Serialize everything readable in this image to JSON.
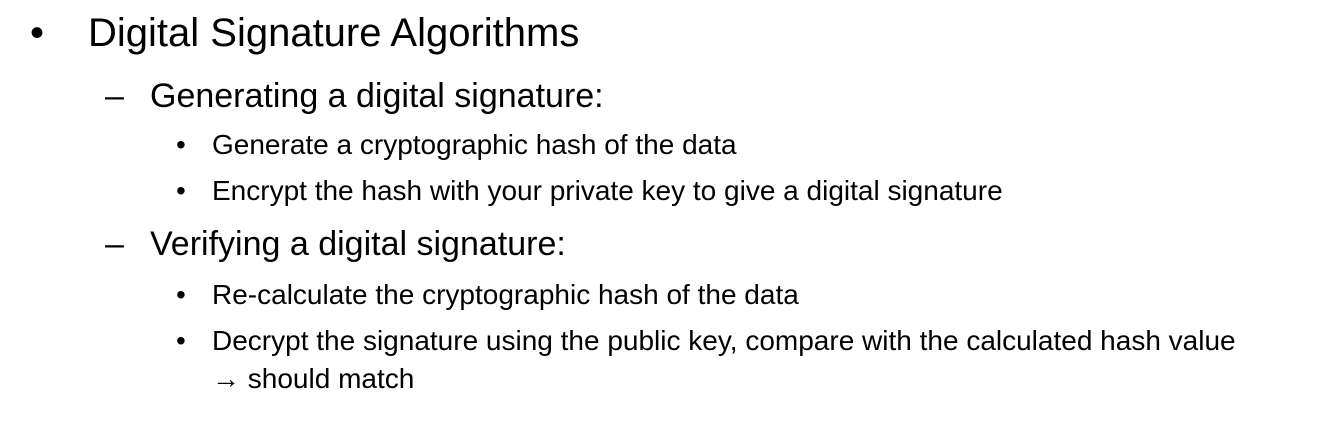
{
  "slide": {
    "heading": {
      "bullet": "•",
      "text": "Digital Signature Algorithms"
    },
    "sections": [
      {
        "dash": "–",
        "title": "Generating a digital signature:",
        "items": [
          {
            "bullet": "•",
            "text": "Generate a cryptographic hash of the data"
          },
          {
            "bullet": "•",
            "text": "Encrypt the hash with your private key to give a digital signature"
          }
        ]
      },
      {
        "dash": "–",
        "title": "Verifying a digital signature:",
        "items": [
          {
            "bullet": "•",
            "text": "Re-calculate the cryptographic hash of the data"
          },
          {
            "bullet": "•",
            "text": "Decrypt the signature using the public key, compare with the calculated hash value",
            "continuation": "→ should match"
          }
        ]
      }
    ]
  }
}
